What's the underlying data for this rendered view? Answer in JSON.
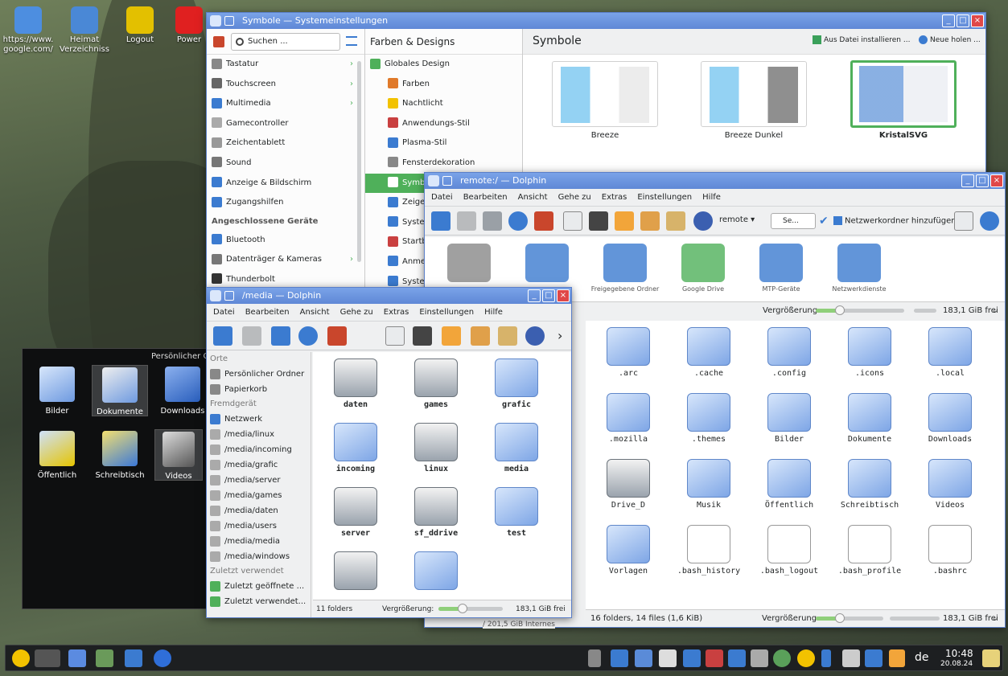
{
  "desktop": {
    "icons": [
      {
        "label": "https://www.\ngoogle.com/",
        "color": "#4d8ee0"
      },
      {
        "label": "Heimat\nVerzeichniss",
        "color": "#4a88d6"
      },
      {
        "label": "Logout",
        "color": "#e3c000"
      },
      {
        "label": "Power",
        "color": "#e02020"
      }
    ]
  },
  "settings": {
    "title": "Symbole — Systemeinstellungen",
    "search_placeholder": "Suchen ...",
    "categories": [
      "Tastatur",
      "Touchscreen",
      "Multimedia",
      "Gamecontroller",
      "Zeichentablett",
      "Sound",
      "Anzeige & Bildschirm",
      "Zugangshilfen"
    ],
    "section_devices": "Angeschlossene Geräte",
    "devices": [
      "Bluetooth",
      "Datenträger & Kameras",
      "Thunderbolt"
    ],
    "mid_header": "Farben & Designs",
    "mid_items": [
      "Globales Design",
      "Farben",
      "Nachtlicht",
      "Anwendungs-Stil",
      "Plasma-Stil",
      "Fensterdekoration",
      "Symbole",
      "Zeiger",
      "Systemklänge",
      "Startbildschirm",
      "Anmeldebildschirm",
      "Systemeinstellungen"
    ],
    "right_header": "Symbole",
    "install_btn": "Aus Datei installieren ...",
    "get_new_btn": "Neue holen ...",
    "themes": [
      "Breeze",
      "Breeze Dunkel",
      "KristalSVG"
    ]
  },
  "remote": {
    "title": "remote:/ — Dolphin",
    "menu": [
      "Datei",
      "Bearbeiten",
      "Ansicht",
      "Gehe zu",
      "Extras",
      "Einstellungen",
      "Hilfe"
    ],
    "location": "remote",
    "search": "Se...",
    "add_network": "Netzwerkordner hinzufügen",
    "remote_items": [
      "",
      "",
      "Freigegebene Ordner",
      "Google Drive",
      "MTP-Geräte",
      "Netzwerkdienste"
    ],
    "zoom_label": "Vergrößerung:",
    "free": "183,1 GiB frei",
    "internal": "/ 201,5 GiB Internes"
  },
  "home": {
    "items": [
      ".arc",
      ".cache",
      ".config",
      ".icons",
      ".local",
      ".mozilla",
      ".themes",
      "Bilder",
      "Dokumente",
      "Downloads",
      "Drive_D",
      "Musik",
      "Öffentlich",
      "Schreibtisch",
      "Videos",
      "Vorlagen",
      ".bash_history",
      ".bash_logout",
      ".bash_profile",
      ".bashrc"
    ],
    "status": "16 folders, 14 files (1,6 KiB)",
    "zoom_label": "Vergrößerung:",
    "free": "183,1 GiB frei"
  },
  "media": {
    "title": "/media — Dolphin",
    "menu": [
      "Datei",
      "Bearbeiten",
      "Ansicht",
      "Gehe zu",
      "Extras",
      "Einstellungen",
      "Hilfe"
    ],
    "places_header": "Orte",
    "places": [
      "Persönlicher Ordner",
      "Papierkorb"
    ],
    "remote_header": "Fremdgerät",
    "remote": [
      "Netzwerk",
      "/media/linux",
      "/media/incoming",
      "/media/grafic",
      "/media/server",
      "/media/games",
      "/media/daten",
      "/media/users",
      "/media/media",
      "/media/windows"
    ],
    "recent_header": "Zuletzt verwendet",
    "recent": [
      "Zuletzt geöffnete ...",
      "Zuletzt verwendet..."
    ],
    "items": [
      "daten",
      "games",
      "grafic",
      "incoming",
      "linux",
      "media",
      "server",
      "sf_ddrive",
      "test",
      "",
      ""
    ],
    "status": "11 folders",
    "zoom_label": "Vergrößerung:",
    "free": "183,1 GiB frei"
  },
  "folderview": {
    "title": "Persönlicher Ordner",
    "items": [
      "Bilder",
      "Dokumente",
      "Downloads",
      "Öffentlich",
      "Schreibtisch",
      "Videos"
    ]
  },
  "taskbar": {
    "keyboard": "de",
    "time": "10:48",
    "date": "20.08.24"
  }
}
